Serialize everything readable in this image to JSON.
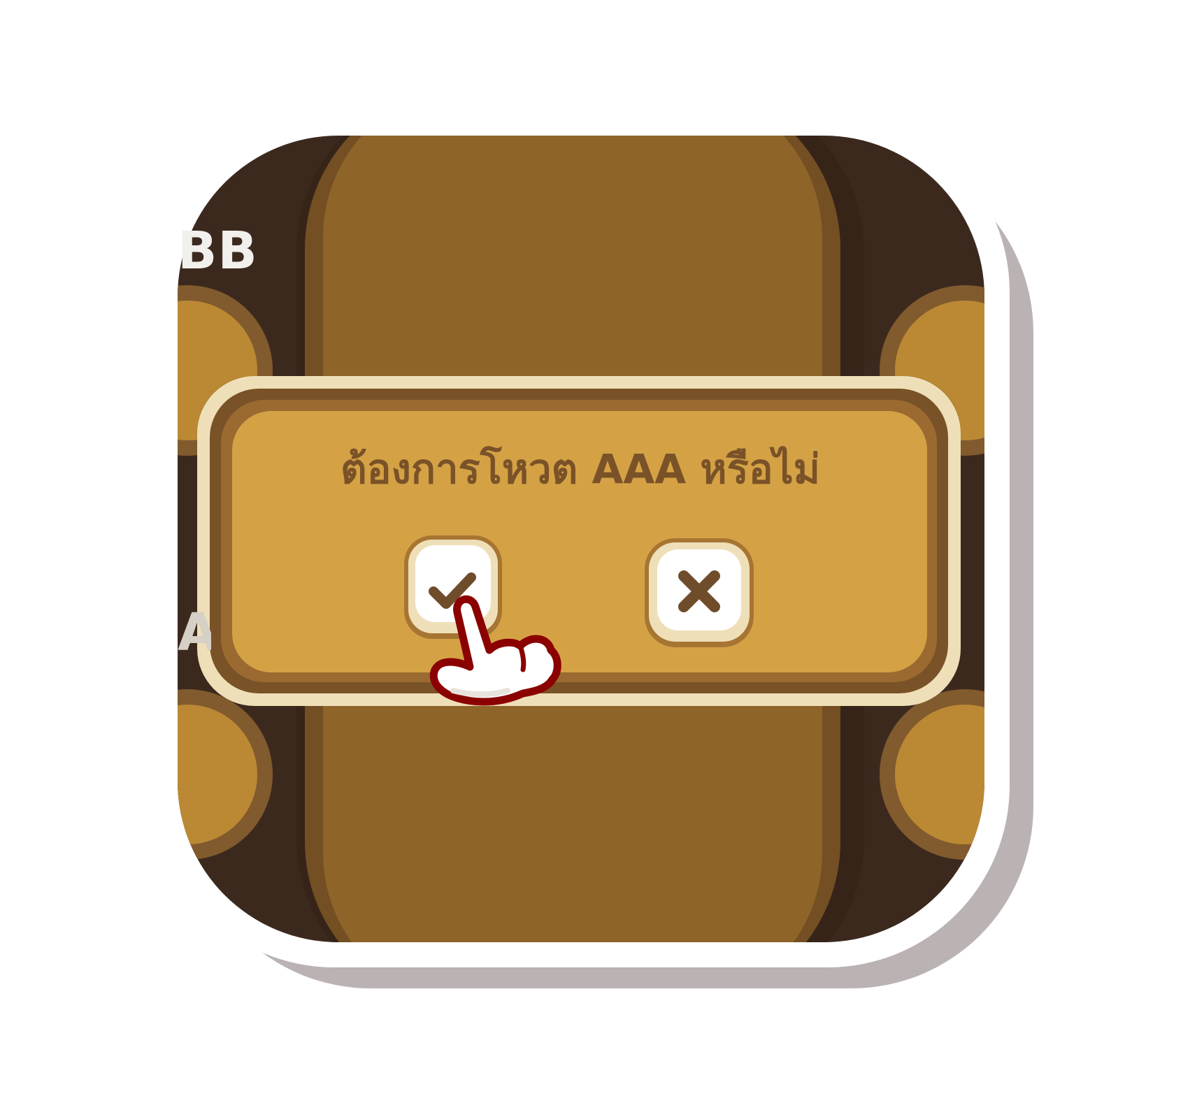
{
  "scene": {
    "player_label_top": "BB",
    "player_label_left": "A"
  },
  "dialog": {
    "question": "ต้องการโหวต AAA หรือไม่"
  },
  "buttons": {
    "confirm_icon": "check-icon",
    "cancel_icon": "close-icon"
  },
  "pointer": {
    "icon": "hand-pointer-icon"
  },
  "colors": {
    "card_dark": "#402c20",
    "table_brown": "#976b2c",
    "dialog_gold": "#d4a245",
    "dialog_border_cream": "#efdfb8",
    "text_brown": "#7a5228",
    "pointer_outline": "#8b0000"
  }
}
